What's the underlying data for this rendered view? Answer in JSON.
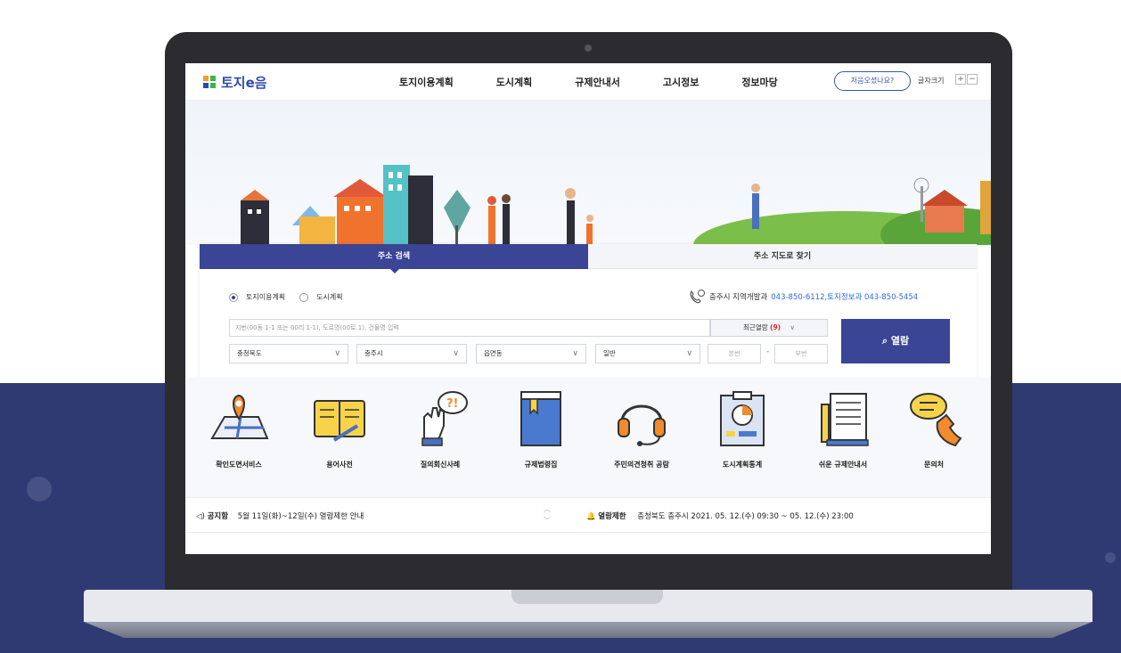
{
  "header": {
    "logo_text": "토지e음",
    "nav": [
      "토지이용계획",
      "도시계획",
      "규제안내서",
      "고시정보",
      "정보마당"
    ],
    "first_visit": "처음오셨나요?",
    "font_size_label": "글자크기",
    "font_plus": "+",
    "font_minus": "−"
  },
  "search": {
    "tab_active": "주소 검색",
    "tab_inactive": "주소 지도로 찾기",
    "radio_options": [
      "토지이용계획",
      "도시계획"
    ],
    "contact_text": "충주시 지역개발과",
    "contact_phones": "043-850-6112,토지정보과 043-850-5454",
    "input_placeholder": "지번(00동 1-1 또는 00리 1-1), 도로명(00로 1), 건물명 입력",
    "recent_label": "최근열람",
    "recent_count": "(9)",
    "view_button": "열람",
    "selects": [
      "충청북도",
      "충주시",
      "읍면동",
      "일반"
    ],
    "main_no": "본번",
    "dash": "-",
    "sub_no": "부번"
  },
  "services": [
    {
      "label": "확인도면서비스",
      "icon": "map-pin-icon"
    },
    {
      "label": "용어사전",
      "icon": "book-icon"
    },
    {
      "label": "질의회신사례",
      "icon": "question-hand-icon"
    },
    {
      "label": "규제법령집",
      "icon": "law-book-icon"
    },
    {
      "label": "주민의견청취 공람",
      "icon": "headset-icon"
    },
    {
      "label": "도시계획통계",
      "icon": "chart-board-icon"
    },
    {
      "label": "쉬운 규제안내서",
      "icon": "document-icon"
    },
    {
      "label": "문의처",
      "icon": "phone-bubble-icon"
    }
  ],
  "notice": {
    "label": "공지함",
    "text": "5월 11일(화)~12일(수) 열람제한 안내",
    "up": "︿",
    "down": "﹀",
    "restriction_label": "열람제한",
    "restriction_text": "충청북도 충주시 2021. 05. 12.(수) 09:30 ~ 05. 12.(수) 23:00"
  },
  "colors": {
    "navy": "#3a4595",
    "background_navy": "#2f3a73",
    "link_blue": "#2e6bd8",
    "logo_blue": "#2e4aa8"
  }
}
